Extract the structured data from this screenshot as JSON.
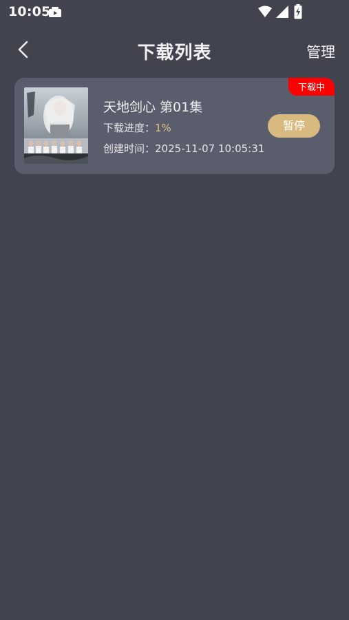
{
  "status_bar": {
    "time": "10:05",
    "icons": [
      "app-notification-icon",
      "wifi-icon",
      "signal-icon",
      "battery-charging-icon"
    ]
  },
  "header": {
    "title": "下载列表",
    "manage_label": "管理",
    "back_icon": "chevron-left-icon"
  },
  "downloads": [
    {
      "title": "天地剑心 第01集",
      "status_badge": "下载中",
      "progress_label": "下载进度：",
      "progress_value": "1%",
      "progress_fraction": 0.01,
      "created_label": "创建时间：",
      "created_value": "2025-11-07 10:05:31",
      "action_label": "暂停"
    }
  ],
  "colors": {
    "background": "#41444f",
    "card": "#5a5d6b",
    "badge": "#ff0000",
    "accent": "#d8b97f",
    "progress_text": "#e2c08a"
  }
}
